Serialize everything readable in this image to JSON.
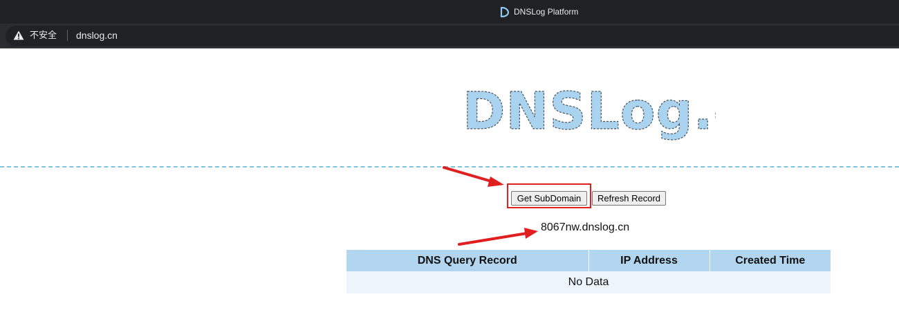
{
  "browser": {
    "window_title": "DNSLog Platform",
    "security_label": "不安全",
    "url": "dnslog.cn"
  },
  "page": {
    "logo_text": "DNSLog.cn",
    "get_subdomain_label": "Get SubDomain",
    "refresh_record_label": "Refresh Record",
    "subdomain_value": "8067nw.dnslog.cn",
    "table": {
      "headers": [
        "DNS Query Record",
        "IP Address",
        "Created Time"
      ],
      "empty_text": "No Data"
    }
  },
  "colors": {
    "accent": "#b3d6f0",
    "annotation": "#e02020"
  },
  "icons": {
    "favicon": "dnslog-favicon-icon",
    "warning": "warning-triangle-icon"
  }
}
